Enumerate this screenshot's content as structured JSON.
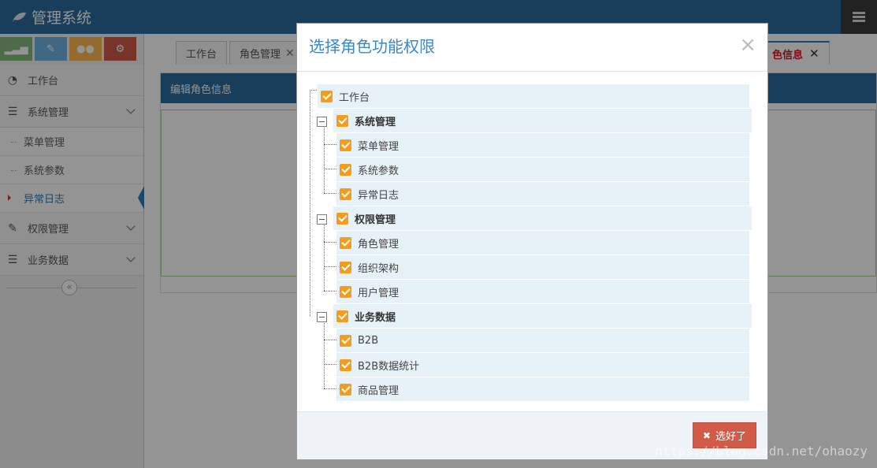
{
  "header": {
    "title": "管理系统",
    "brand_icon": "leaf-icon",
    "menu_icon": "hamburger-icon"
  },
  "shortcuts": [
    {
      "icon": "signal-icon",
      "color": "#87b87f"
    },
    {
      "icon": "pencil-icon",
      "color": "#6fb3e0"
    },
    {
      "icon": "users-icon",
      "color": "#ffb752"
    },
    {
      "icon": "cogs-icon",
      "color": "#d15b47"
    }
  ],
  "sidebar": {
    "items": [
      {
        "label": "工作台"
      },
      {
        "label": "系统管理"
      },
      {
        "label": "权限管理"
      },
      {
        "label": "业务数据"
      }
    ],
    "sub_items": [
      {
        "label": "菜单管理"
      },
      {
        "label": "系统参数"
      },
      {
        "label": "异常日志"
      }
    ],
    "collapse": "«"
  },
  "tabs": [
    {
      "label": "工作台"
    },
    {
      "label": "角色管理"
    }
  ],
  "active_tab": {
    "label": "色信息",
    "close": "✕"
  },
  "panel": {
    "title": "编辑角色信息"
  },
  "modal": {
    "title": "选择角色功能权限",
    "close": "×",
    "done_button": "选好了",
    "done_icon": "✖",
    "tree": [
      {
        "label": "工作台",
        "checked": true
      },
      {
        "label": "系统管理",
        "checked": true,
        "children": [
          {
            "label": "菜单管理",
            "checked": true
          },
          {
            "label": "系统参数",
            "checked": true
          },
          {
            "label": "异常日志",
            "checked": true
          }
        ]
      },
      {
        "label": "权限管理",
        "checked": true,
        "children": [
          {
            "label": "角色管理",
            "checked": true
          },
          {
            "label": "组织架构",
            "checked": true
          },
          {
            "label": "用户管理",
            "checked": true
          }
        ]
      },
      {
        "label": "业务数据",
        "checked": true,
        "children": [
          {
            "label": "B2B",
            "checked": true
          },
          {
            "label": "B2B数据统计",
            "checked": true
          },
          {
            "label": "商品管理",
            "checked": true
          }
        ]
      }
    ]
  },
  "watermark": "https://blog.csdn.net/ohaozy",
  "colors": {
    "header": "#2a6b9e",
    "checkbox": "#f59c1a",
    "danger": "#d15b47",
    "title": "#3d87c4"
  }
}
